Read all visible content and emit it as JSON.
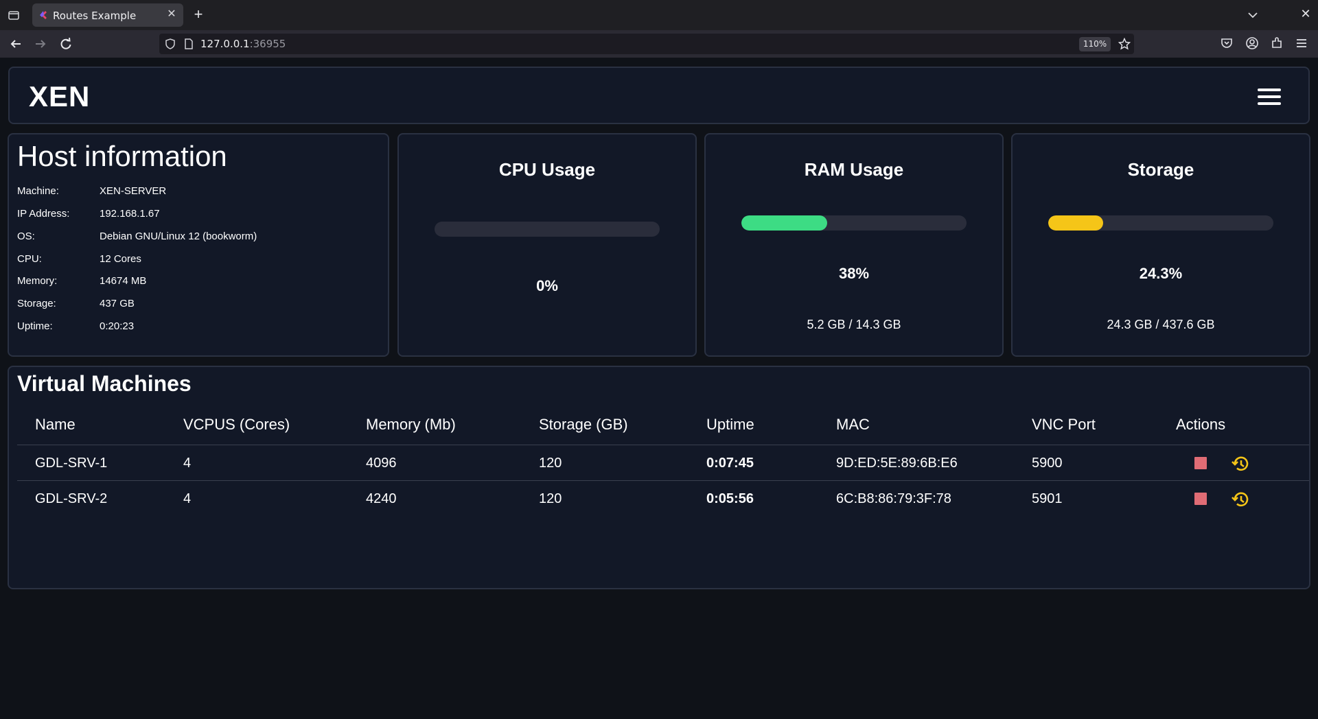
{
  "browser": {
    "tab_title": "Routes Example",
    "url_host": "127.0.0.1",
    "url_port": ":36955",
    "zoom": "110%"
  },
  "app": {
    "brand": "XEN"
  },
  "host": {
    "title": "Host information",
    "rows": [
      {
        "label": "Machine:",
        "value": "XEN-SERVER"
      },
      {
        "label": "IP Address:",
        "value": "192.168.1.67"
      },
      {
        "label": "OS:",
        "value": "Debian GNU/Linux 12 (bookworm)"
      },
      {
        "label": "CPU:",
        "value": "12 Cores"
      },
      {
        "label": "Memory:",
        "value": "14674 MB"
      },
      {
        "label": "Storage:",
        "value": "437 GB"
      },
      {
        "label": "Uptime:",
        "value": "0:20:23"
      }
    ]
  },
  "metrics": {
    "cpu": {
      "title": "CPU Usage",
      "percent_text": "0%",
      "fill": 0,
      "detail": ""
    },
    "ram": {
      "title": "RAM Usage",
      "percent_text": "38%",
      "fill": 0.38,
      "detail": "5.2 GB / 14.3 GB",
      "color": "#3ddc84"
    },
    "storage": {
      "title": "Storage",
      "percent_text": "24.3%",
      "fill": 0.243,
      "detail": "24.3 GB / 437.6 GB",
      "color": "#f5c518"
    }
  },
  "vms": {
    "title": "Virtual Machines",
    "headers": [
      "Name",
      "VCPUS (Cores)",
      "Memory (Mb)",
      "Storage (GB)",
      "Uptime",
      "MAC",
      "VNC Port",
      "Actions"
    ],
    "rows": [
      {
        "name": "GDL-SRV-1",
        "vcpus": "4",
        "memory": "4096",
        "storage": "120",
        "uptime": "0:07:45",
        "mac": "9D:ED:5E:89:6B:E6",
        "vnc": "5900"
      },
      {
        "name": "GDL-SRV-2",
        "vcpus": "4",
        "memory": "4240",
        "storage": "120",
        "uptime": "0:05:56",
        "mac": "6C:B8:86:79:3F:78",
        "vnc": "5901"
      }
    ],
    "stop_color": "#e06c75",
    "restart_color": "#f5c518"
  }
}
